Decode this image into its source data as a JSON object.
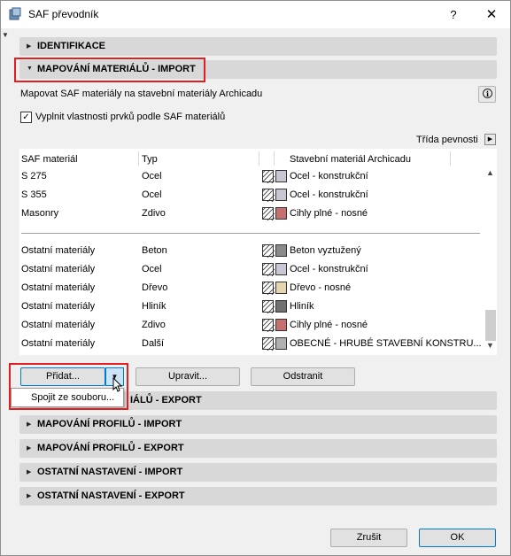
{
  "window": {
    "title": "SAF převodník",
    "help_label": "?",
    "close_label": "✕"
  },
  "sections": {
    "identifikace": "IDENTIFIKACE",
    "mapovani_import": "MAPOVÁNÍ MATERIÁLŮ - IMPORT",
    "mapovani_export_partial": "IÁLŮ - EXPORT",
    "profily_import": "MAPOVÁNÍ PROFILŮ - IMPORT",
    "profily_export": "MAPOVÁNÍ PROFILŮ - EXPORT",
    "ostatni_import": "OSTATNÍ NASTAVENÍ - IMPORT",
    "ostatni_export": "OSTATNÍ NASTAVENÍ - EXPORT"
  },
  "import_panel": {
    "description": "Mapovat SAF materiály na stavební materiály Archicadu",
    "info_icon": "i",
    "checkbox_label": "Vyplnit vlastnosti prvků podle SAF materiálů",
    "checkbox_checked": "✓",
    "strength_class_label": "Třída pevnosti"
  },
  "table": {
    "headers": {
      "saf_material": "SAF materiál",
      "type": "Typ",
      "building_material": "Stavební materiál Archicadu"
    },
    "rows_specific": [
      {
        "saf": "S 275",
        "type": "Ocel",
        "material": "Ocel - konstrukční",
        "swatch": "#c8c8d4"
      },
      {
        "saf": "S 355",
        "type": "Ocel",
        "material": "Ocel - konstrukční",
        "swatch": "#c8c8d4"
      },
      {
        "saf": "Masonry",
        "type": "Zdivo",
        "material": "Cihly plné - nosné",
        "swatch": "#c87070"
      }
    ],
    "rows_other": [
      {
        "saf": "Ostatní materiály",
        "type": "Beton",
        "material": "Beton vyztužený",
        "swatch": "#8a8a8a"
      },
      {
        "saf": "Ostatní materiály",
        "type": "Ocel",
        "material": "Ocel - konstrukční",
        "swatch": "#c8c8d4"
      },
      {
        "saf": "Ostatní materiály",
        "type": "Dřevo",
        "material": "Dřevo - nosné",
        "swatch": "#e6d6b0"
      },
      {
        "saf": "Ostatní materiály",
        "type": "Hliník",
        "material": "Hliník",
        "swatch": "#707070"
      },
      {
        "saf": "Ostatní materiály",
        "type": "Zdivo",
        "material": "Cihly plné - nosné",
        "swatch": "#c87070"
      },
      {
        "saf": "Ostatní materiály",
        "type": "Další",
        "material": "OBECNÉ - HRUBÉ STAVEBNÍ KONSTRU...",
        "swatch": "#b0b0b0"
      }
    ]
  },
  "buttons": {
    "add": "Přidat...",
    "edit": "Upravit...",
    "remove": "Odstranit",
    "cancel": "Zrušit",
    "ok": "OK"
  },
  "dropdown": {
    "merge_from_file": "Spojit ze souboru..."
  },
  "colors": {
    "highlight_red": "#e02020",
    "focus_blue": "#0078d7"
  }
}
